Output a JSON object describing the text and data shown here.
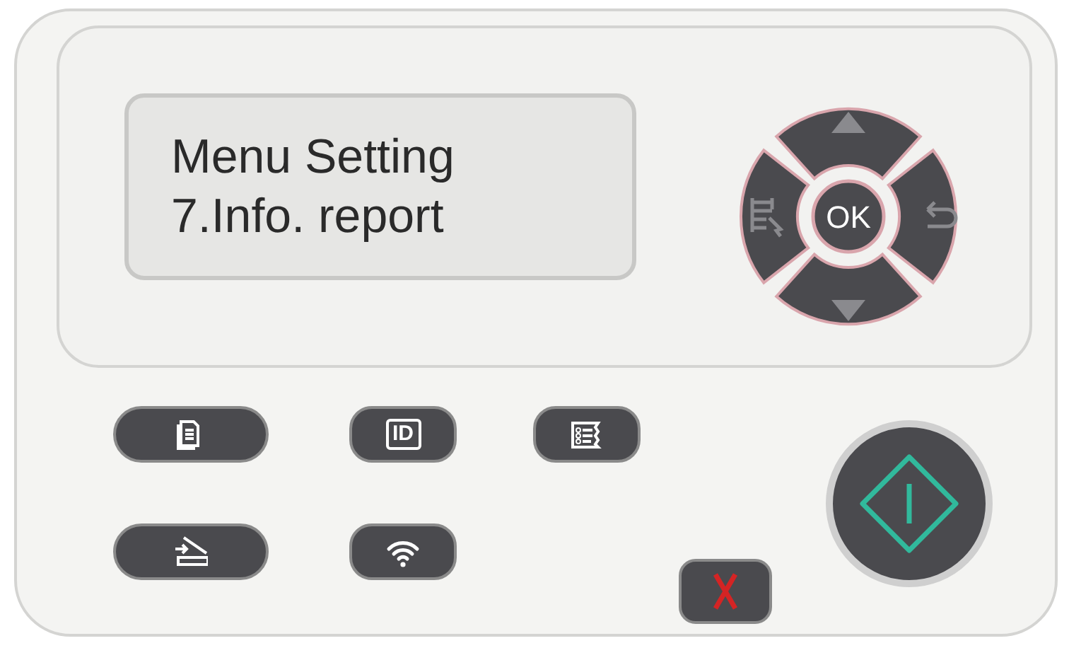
{
  "display": {
    "lines": [
      "Menu Setting",
      "7.Info. report"
    ]
  },
  "navigation": {
    "ok_label": "OK"
  },
  "function_buttons": [
    {
      "kind": "copy"
    },
    {
      "kind": "id_copy",
      "label": "ID"
    },
    {
      "kind": "report"
    },
    {
      "kind": "scan"
    },
    {
      "kind": "wifi"
    }
  ]
}
